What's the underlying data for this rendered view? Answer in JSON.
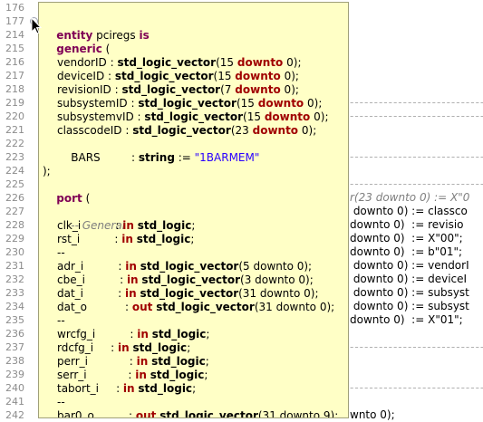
{
  "editor": {
    "line_numbers": [
      "176",
      "177",
      "214",
      "215",
      "216",
      "217",
      "218",
      "219",
      "220",
      "221",
      "222",
      "223",
      "224",
      "225",
      "226",
      "227",
      "228",
      "229",
      "230",
      "231",
      "232",
      "233",
      "234",
      "235",
      "236",
      "237",
      "238",
      "239",
      "240",
      "241",
      "242"
    ],
    "bg_right": [
      {
        "text": "",
        "kind": "blank"
      },
      {
        "text": "",
        "kind": "blank"
      },
      {
        "text": "",
        "kind": "blank"
      },
      {
        "text": "",
        "kind": "blank"
      },
      {
        "text": "",
        "kind": "blank"
      },
      {
        "text": "",
        "kind": "blank"
      },
      {
        "text": "",
        "kind": "blank"
      },
      {
        "text": "-----------------------------",
        "kind": "dash"
      },
      {
        "text": "-----------------------------",
        "kind": "dash"
      },
      {
        "text": "",
        "kind": "blank"
      },
      {
        "text": "",
        "kind": "blank"
      },
      {
        "text": "-----------------------------",
        "kind": "dash"
      },
      {
        "text": "",
        "kind": "blank"
      },
      {
        "text": "-----------------------------",
        "kind": "dash"
      },
      {
        "text": "r(23 downto 0) := X\"0",
        "kind": "cmt"
      },
      {
        "text": " downto 0) := classco",
        "kind": "code"
      },
      {
        "text": "downto 0)  := revisio",
        "kind": "code"
      },
      {
        "text": "downto 0)  := X\"00\";",
        "kind": "code"
      },
      {
        "text": "downto 0)  := b\"01\";",
        "kind": "code"
      },
      {
        "text": " downto 0) := vendorI",
        "kind": "code"
      },
      {
        "text": " downto 0) := deviceI",
        "kind": "code"
      },
      {
        "text": " downto 0) := subsyst",
        "kind": "code"
      },
      {
        "text": " downto 0) := subsyst",
        "kind": "code"
      },
      {
        "text": "downto 0)  := X\"01\";",
        "kind": "code"
      },
      {
        "text": "",
        "kind": "blank"
      },
      {
        "text": "-----------------------------",
        "kind": "dash"
      },
      {
        "text": "",
        "kind": "blank"
      },
      {
        "text": "",
        "kind": "blank"
      },
      {
        "text": "-----------------------------",
        "kind": "dash"
      },
      {
        "text": "",
        "kind": "blank"
      },
      {
        "text": "wnto 0);",
        "kind": "code"
      }
    ]
  },
  "hover": {
    "l1_entity": "entity",
    "l1_name": " pciregs ",
    "l1_is": "is",
    "l2_generic": "generic",
    "l2_paren": " (",
    "generics": [
      {
        "name": "vendorID : ",
        "type": "std_logic_vector",
        "open": "(",
        "hi": "15",
        "dt": "downto",
        "lo": "0",
        "close": ");"
      },
      {
        "name": "deviceID : ",
        "type": "std_logic_vector",
        "open": "(",
        "hi": "15",
        "dt": "downto",
        "lo": "0",
        "close": ");"
      },
      {
        "name": "revisionID : ",
        "type": "std_logic_vector",
        "open": "(",
        "hi": "7",
        "dt": "downto",
        "lo": "0",
        "close": ");"
      },
      {
        "name": "subsystemID : ",
        "type": "std_logic_vector",
        "open": "(",
        "hi": "15",
        "dt": "downto",
        "lo": "0",
        "close": ");"
      },
      {
        "name": "subsystemvID : ",
        "type": "std_logic_vector",
        "open": "(",
        "hi": "15",
        "dt": "downto",
        "lo": "0",
        "close": ");"
      },
      {
        "name": "classcodeID : ",
        "type": "std_logic_vector",
        "open": "(",
        "hi": "23",
        "dt": "downto",
        "lo": "0",
        "close": ");"
      }
    ],
    "bars_name": "BARS         : ",
    "bars_type": "string",
    "bars_assign": " := ",
    "bars_value": "\"1BARMEM\"",
    "close_generic": ");",
    "port_kw": "port",
    "port_paren": " (",
    "comment_dash": "-- ",
    "comment_general": "General",
    "ports": [
      {
        "name": "clk_i          : ",
        "dir": "in",
        "type": "std_logic",
        "rest": ";"
      },
      {
        "name": "rst_i          : ",
        "dir": "in",
        "type": "std_logic",
        "rest": ";"
      },
      {
        "name": "--",
        "dir": "",
        "type": "",
        "rest": ""
      },
      {
        "name": "adr_i          : ",
        "dir": "in",
        "type": "std_logic_vector",
        "rest": "(5 downto 0);"
      },
      {
        "name": "cbe_i          : ",
        "dir": "in",
        "type": "std_logic_vector",
        "rest": "(3 downto 0);"
      },
      {
        "name": "dat_i          : ",
        "dir": "in",
        "type": "std_logic_vector",
        "rest": "(31 downto 0);"
      },
      {
        "name": "dat_o           : ",
        "dir": "out",
        "type": "std_logic_vector",
        "rest": "(31 downto 0);"
      },
      {
        "name": "--",
        "dir": "",
        "type": "",
        "rest": ""
      },
      {
        "name": "wrcfg_i          : ",
        "dir": "in",
        "type": "std_logic",
        "rest": ";"
      },
      {
        "name": "rdcfg_i     : ",
        "dir": "in",
        "type": "std_logic",
        "rest": ";"
      },
      {
        "name": "perr_i            : ",
        "dir": "in",
        "type": "std_logic",
        "rest": ";"
      },
      {
        "name": "serr_i            : ",
        "dir": "in",
        "type": "std_logic",
        "rest": ";"
      },
      {
        "name": "tabort_i     : ",
        "dir": "in",
        "type": "std_logic",
        "rest": ";"
      },
      {
        "name": "--",
        "dir": "",
        "type": "",
        "rest": ""
      },
      {
        "name": "bar0_o          : ",
        "dir": "out",
        "type": "std_logic_vector",
        "rest": "(31 downto 9);"
      }
    ]
  }
}
